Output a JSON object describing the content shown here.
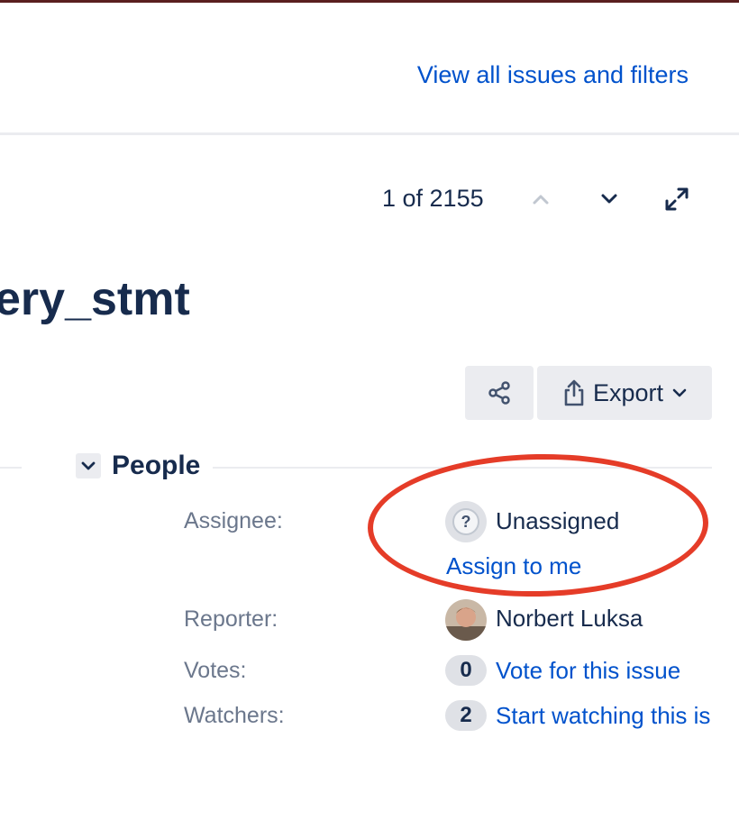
{
  "header": {
    "view_all_link": "View all issues and filters"
  },
  "pager": {
    "text": "1 of 2155"
  },
  "issue": {
    "title": "ery_stmt"
  },
  "toolbar": {
    "share_icon": "share-icon",
    "export_label": "Export"
  },
  "people": {
    "section_title": "People",
    "assignee_label": "Assignee:",
    "assignee_value": "Unassigned",
    "assign_to_me": "Assign to me",
    "reporter_label": "Reporter:",
    "reporter_value": "Norbert Luksa",
    "votes_label": "Votes:",
    "votes_count": "0",
    "vote_link": "Vote for this issue",
    "watchers_label": "Watchers:",
    "watchers_count": "2",
    "watch_link": "Start watching this is"
  },
  "colors": {
    "link": "#0052cc",
    "text": "#172b4d",
    "muted": "#6b778c",
    "annotation": "#e53c28"
  }
}
